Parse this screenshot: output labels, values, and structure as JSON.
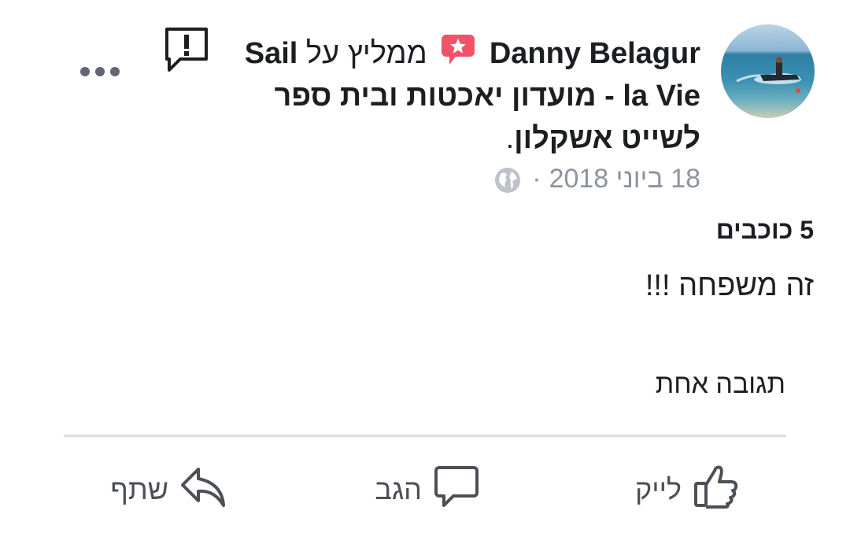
{
  "header": {
    "author": "Danny Belagur",
    "recommends_text": "ממליץ על",
    "page_name_part1": "Sail",
    "page_name_part2": "la Vie - מועדון יאכטות ובית ספר",
    "page_name_part3": "לשייט אשקלון",
    "period": "."
  },
  "meta": {
    "date": "18 ביוני 2018",
    "separator": "·",
    "privacy_icon": "globe-icon"
  },
  "review": {
    "rating": "5 כוכבים",
    "text": "זה משפחה !!!"
  },
  "replies": {
    "label": "תגובה אחת"
  },
  "actions": {
    "like": "לייק",
    "comment": "הגב",
    "share": "שתף"
  },
  "icons": {
    "recommend": "recommend-star-icon",
    "report": "report-icon",
    "more": "more-icon"
  },
  "colors": {
    "recommend_badge": "#f25268",
    "meta_text": "#8d949e",
    "action_text": "#4b4f56",
    "divider": "#dadde1"
  }
}
